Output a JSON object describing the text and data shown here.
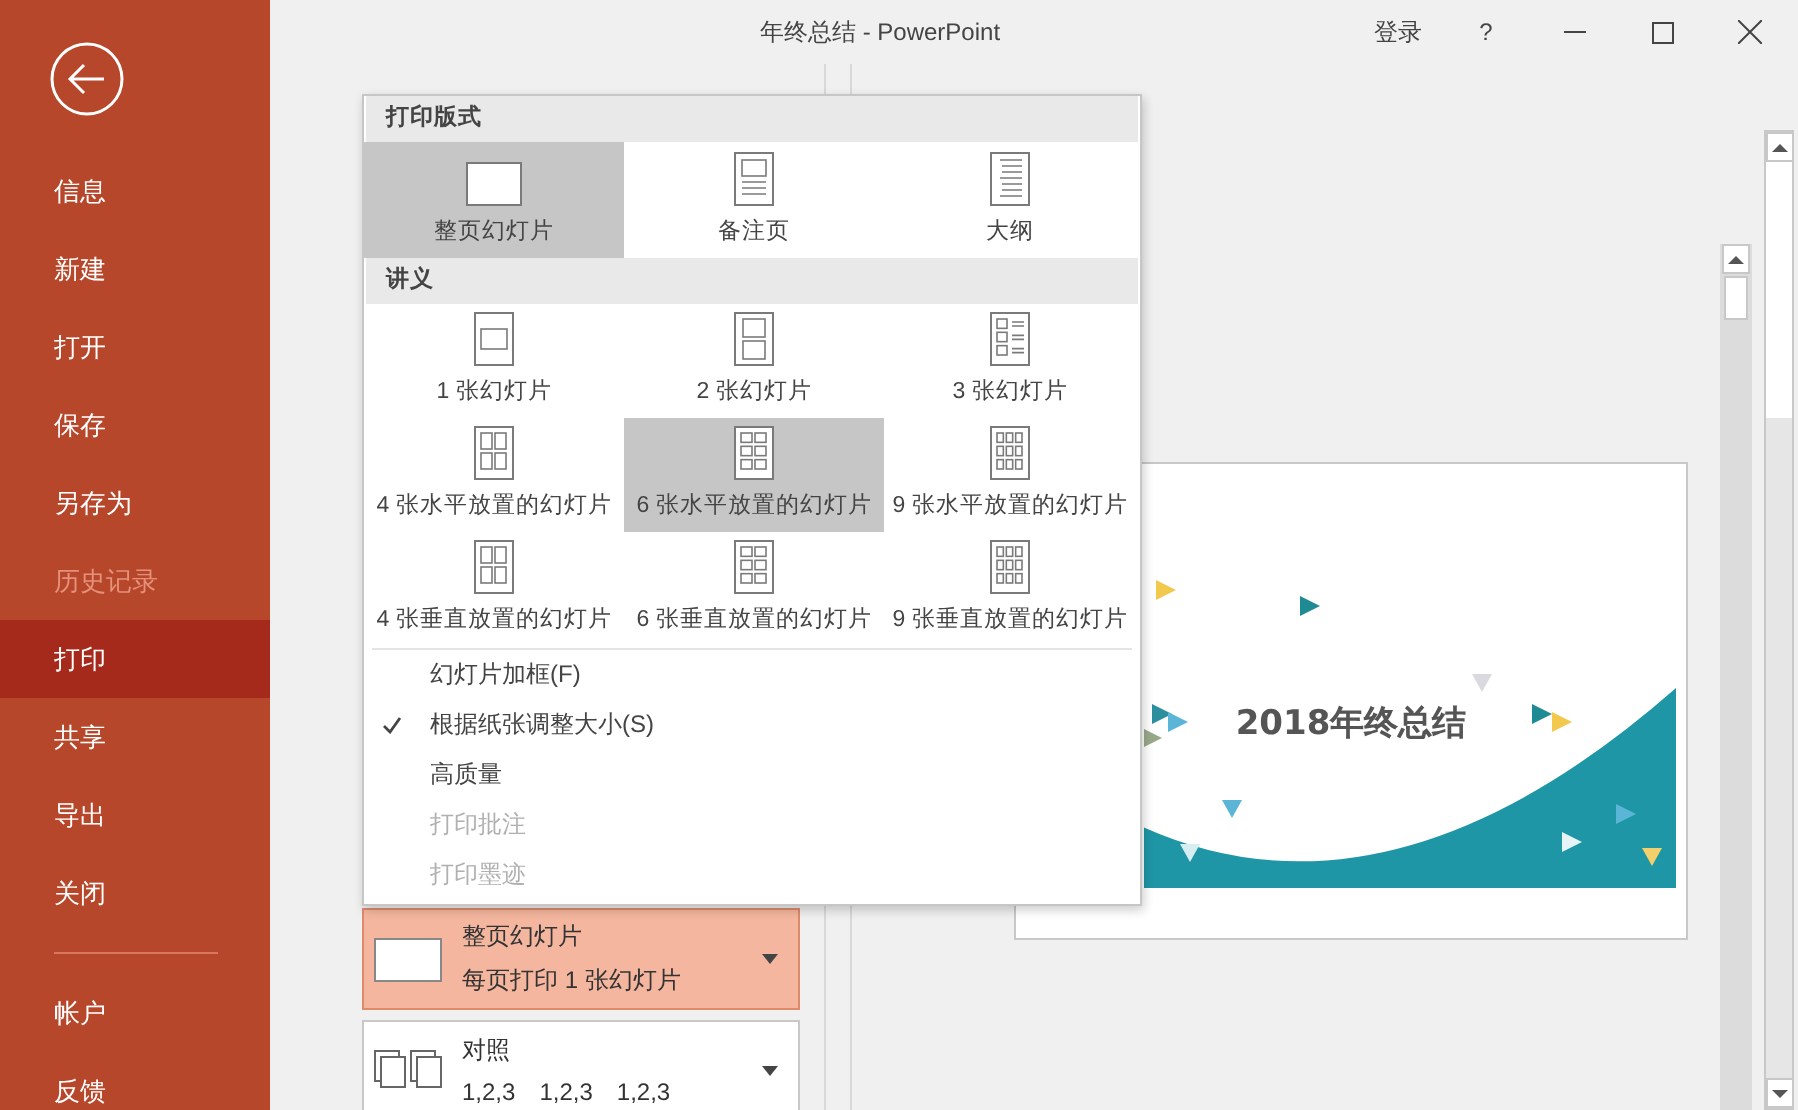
{
  "window": {
    "title": "年终总结  -  PowerPoint",
    "sign_in": "登录",
    "help": "?"
  },
  "sidebar": {
    "items": [
      {
        "label": "信息",
        "selected": false,
        "disabled": false
      },
      {
        "label": "新建",
        "selected": false,
        "disabled": false
      },
      {
        "label": "打开",
        "selected": false,
        "disabled": false
      },
      {
        "label": "保存",
        "selected": false,
        "disabled": false
      },
      {
        "label": "另存为",
        "selected": false,
        "disabled": false
      },
      {
        "label": "历史记录",
        "selected": false,
        "disabled": true
      },
      {
        "label": "打印",
        "selected": true,
        "disabled": false
      },
      {
        "label": "共享",
        "selected": false,
        "disabled": false
      },
      {
        "label": "导出",
        "selected": false,
        "disabled": false
      },
      {
        "label": "关闭",
        "selected": false,
        "disabled": false
      }
    ],
    "bottom_items": [
      {
        "label": "帐户",
        "selected": false,
        "disabled": false
      },
      {
        "label": "反馈",
        "selected": false,
        "disabled": false
      }
    ]
  },
  "print_menu": {
    "sections": [
      {
        "title": "打印版式",
        "options": [
          {
            "label": "整页幻灯片",
            "kind": "full",
            "selected": true
          },
          {
            "label": "备注页",
            "kind": "notes",
            "selected": false
          },
          {
            "label": "大纲",
            "kind": "outline",
            "selected": false
          }
        ]
      },
      {
        "title": "讲义",
        "options": [
          {
            "label": "1 张幻灯片",
            "kind": "h1",
            "selected": false
          },
          {
            "label": "2 张幻灯片",
            "kind": "h2",
            "selected": false
          },
          {
            "label": "3 张幻灯片",
            "kind": "h3",
            "selected": false
          },
          {
            "label": "4 张水平放置的幻灯片",
            "kind": "h4",
            "selected": false
          },
          {
            "label": "6 张水平放置的幻灯片",
            "kind": "h6",
            "selected": true
          },
          {
            "label": "9 张水平放置的幻灯片",
            "kind": "h9",
            "selected": false
          },
          {
            "label": "4 张垂直放置的幻灯片",
            "kind": "v4",
            "selected": false
          },
          {
            "label": "6 张垂直放置的幻灯片",
            "kind": "v6",
            "selected": false
          },
          {
            "label": "9 张垂直放置的幻灯片",
            "kind": "v9",
            "selected": false
          }
        ]
      }
    ],
    "settings": [
      {
        "label": "幻灯片加框(F)",
        "checked": false,
        "disabled": false
      },
      {
        "label": "根据纸张调整大小(S)",
        "checked": true,
        "disabled": false
      },
      {
        "label": "高质量",
        "checked": false,
        "disabled": false
      },
      {
        "label": "打印批注",
        "checked": false,
        "disabled": true
      },
      {
        "label": "打印墨迹",
        "checked": false,
        "disabled": true
      }
    ]
  },
  "layout_button": {
    "title": "整页幻灯片",
    "subtitle": "每页打印 1 张幻灯片"
  },
  "collation": {
    "title": "对照",
    "sequences": [
      "1,2,3",
      "1,2,3",
      "1,2,3"
    ]
  },
  "slide": {
    "title": "2018年终总结"
  }
}
